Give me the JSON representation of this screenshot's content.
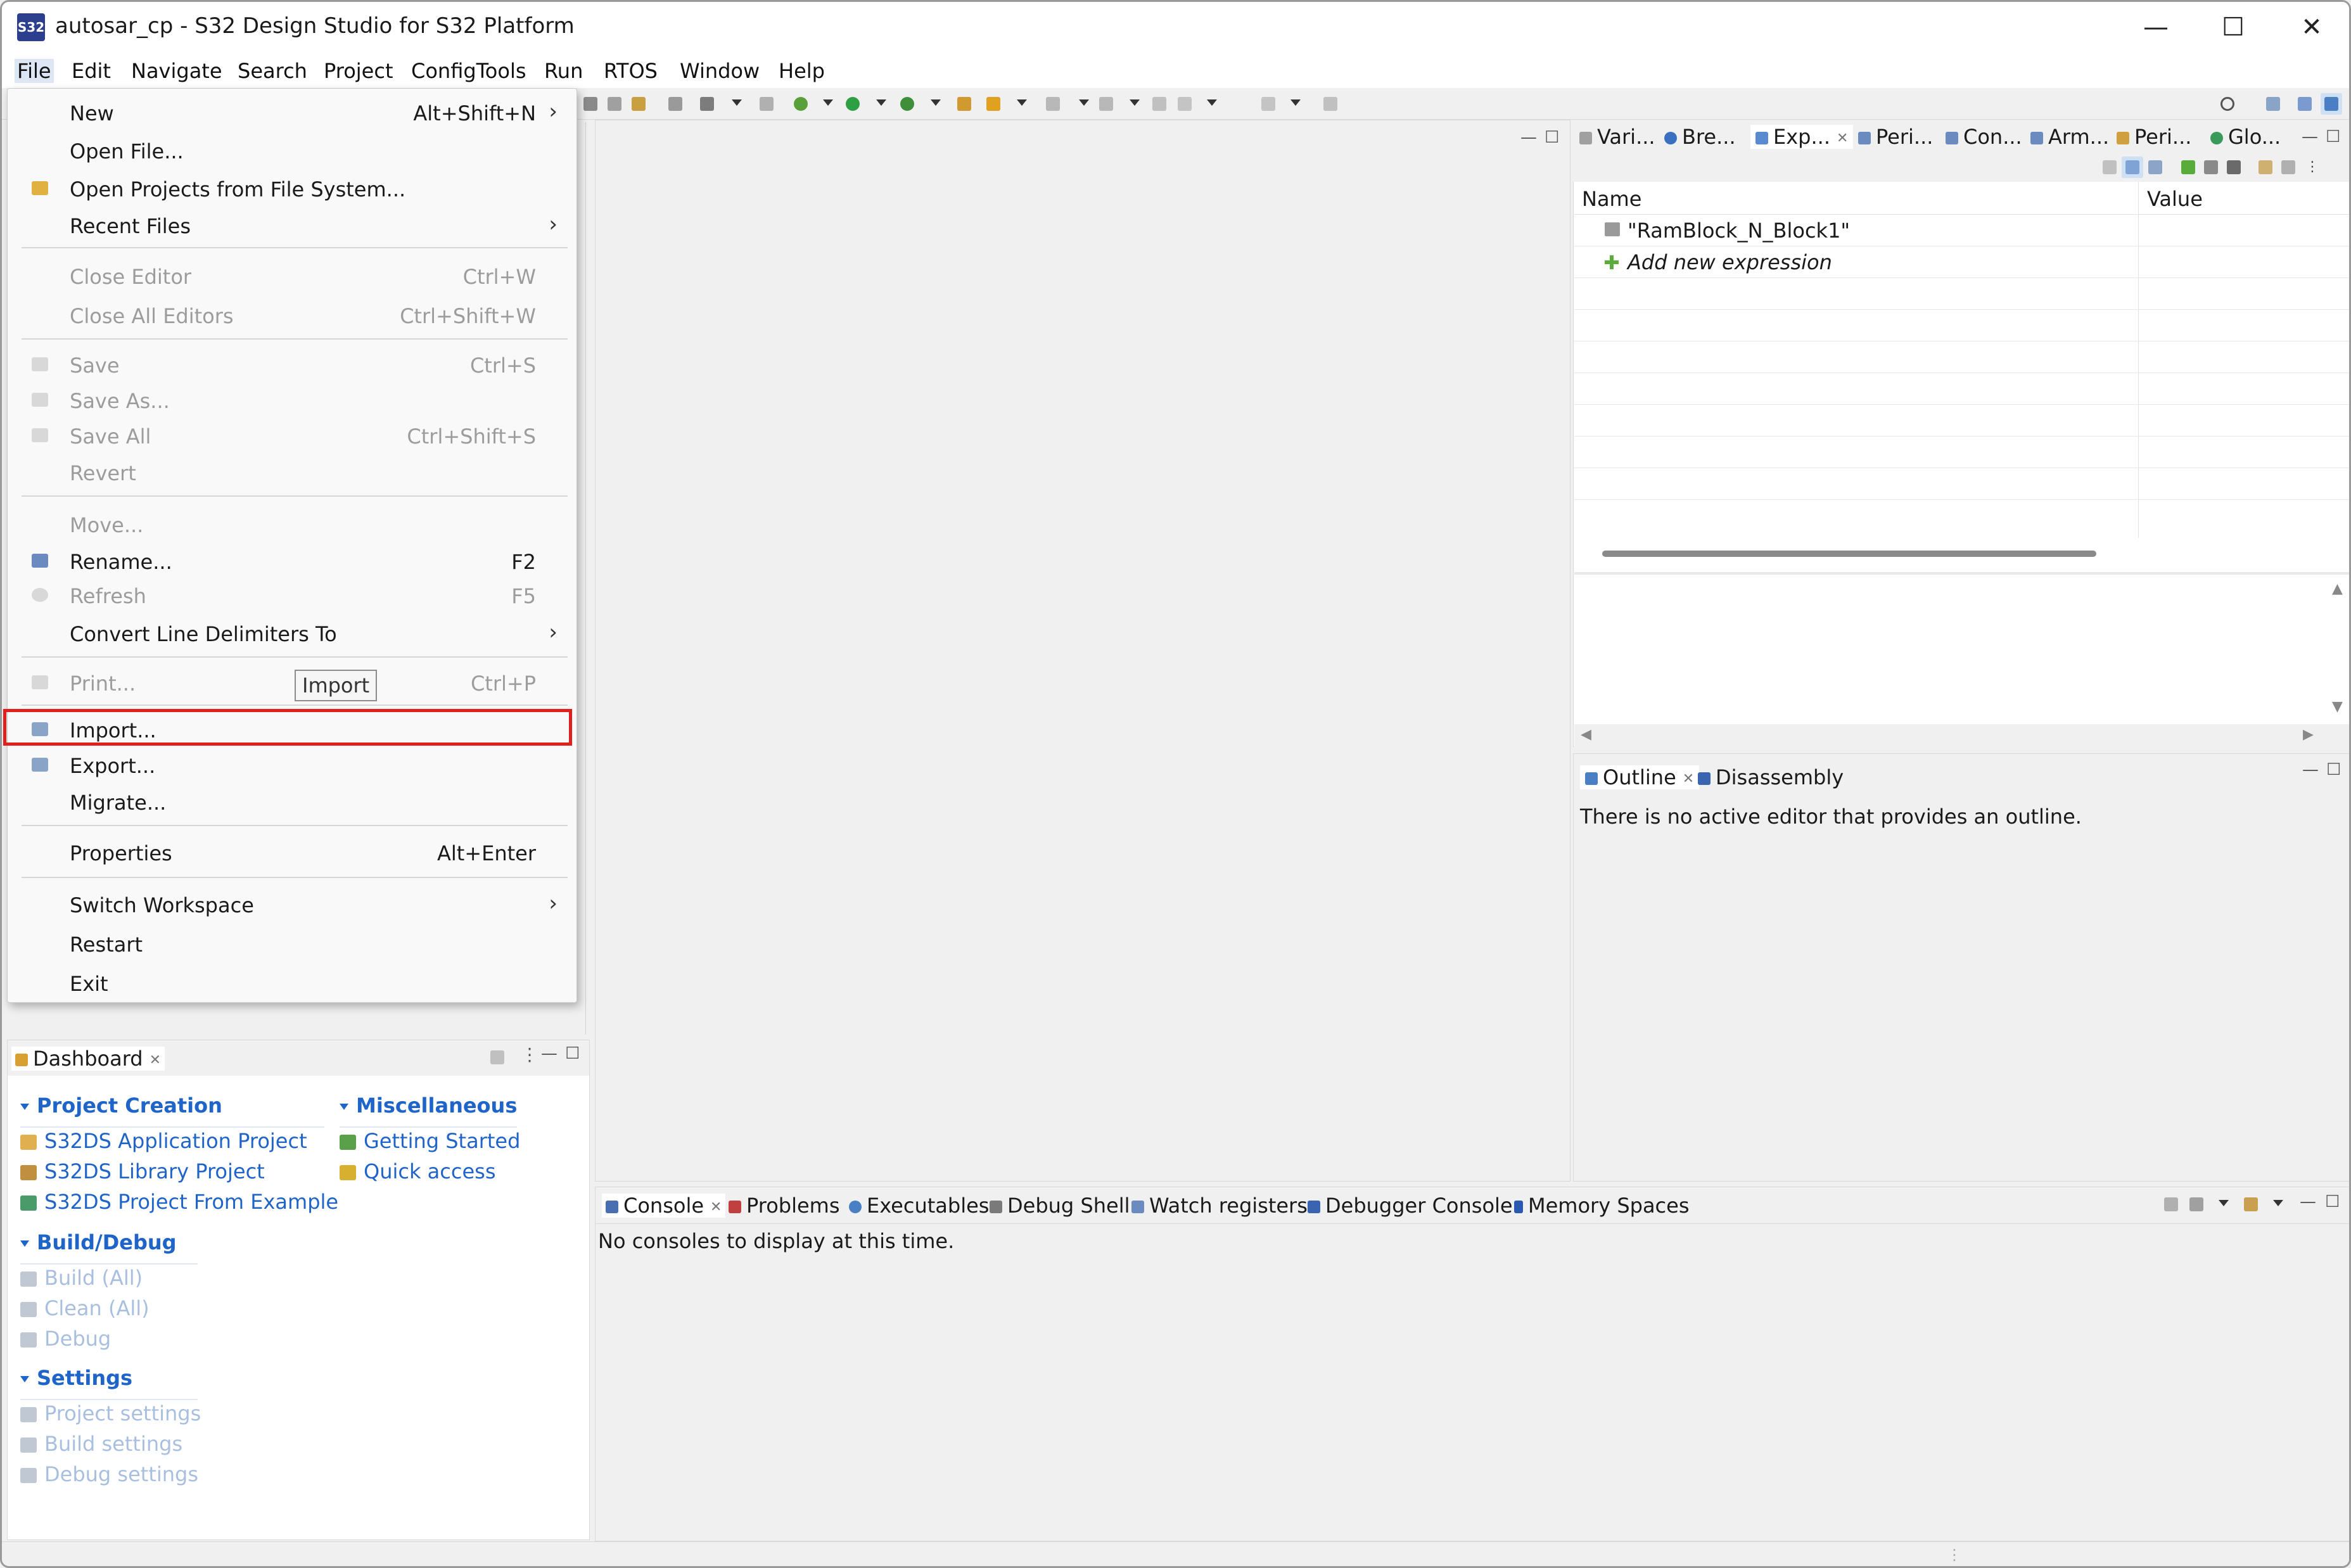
{
  "window": {
    "title": "autosar_cp - S32 Design Studio for S32 Platform",
    "app_icon_text": "S32",
    "controls": {
      "minimize": "—",
      "maximize": "☐",
      "close": "✕"
    }
  },
  "menubar": [
    {
      "label": "File"
    },
    {
      "label": "Edit"
    },
    {
      "label": "Navigate"
    },
    {
      "label": "Search"
    },
    {
      "label": "Project"
    },
    {
      "label": "ConfigTools"
    },
    {
      "label": "Run"
    },
    {
      "label": "RTOS"
    },
    {
      "label": "Window"
    },
    {
      "label": "Help"
    }
  ],
  "file_menu": {
    "items": [
      {
        "label": "New",
        "shortcut": "Alt+Shift+N",
        "submenu": true,
        "enabled": true
      },
      {
        "label": "Open File...",
        "shortcut": "",
        "enabled": true
      },
      {
        "label": "Open Projects from File System...",
        "shortcut": "",
        "enabled": true
      },
      {
        "label": "Recent Files",
        "shortcut": "",
        "submenu": true,
        "enabled": true
      },
      {
        "label": "Close Editor",
        "shortcut": "Ctrl+W",
        "enabled": false
      },
      {
        "label": "Close All Editors",
        "shortcut": "Ctrl+Shift+W",
        "enabled": false
      },
      {
        "label": "Save",
        "shortcut": "Ctrl+S",
        "enabled": false
      },
      {
        "label": "Save As...",
        "shortcut": "",
        "enabled": false
      },
      {
        "label": "Save All",
        "shortcut": "Ctrl+Shift+S",
        "enabled": false
      },
      {
        "label": "Revert",
        "shortcut": "",
        "enabled": false
      },
      {
        "label": "Move...",
        "shortcut": "",
        "enabled": false
      },
      {
        "label": "Rename...",
        "shortcut": "F2",
        "enabled": true
      },
      {
        "label": "Refresh",
        "shortcut": "F5",
        "enabled": false
      },
      {
        "label": "Convert Line Delimiters To",
        "shortcut": "",
        "submenu": true,
        "enabled": true
      },
      {
        "label": "Print...",
        "shortcut": "Ctrl+P",
        "enabled": false
      },
      {
        "label": "Import...",
        "shortcut": "",
        "enabled": true,
        "highlighted": true
      },
      {
        "label": "Export...",
        "shortcut": "",
        "enabled": true
      },
      {
        "label": "Migrate...",
        "shortcut": "",
        "enabled": true
      },
      {
        "label": "Properties",
        "shortcut": "Alt+Enter",
        "enabled": true
      },
      {
        "label": "Switch Workspace",
        "shortcut": "",
        "submenu": true,
        "enabled": true
      },
      {
        "label": "Restart",
        "shortcut": "",
        "enabled": true
      },
      {
        "label": "Exit",
        "shortcut": "",
        "enabled": true
      }
    ],
    "tooltip": "Import",
    "submenu_arrow": "›"
  },
  "top_right_tabs": [
    {
      "label": "Vari...",
      "icon": "variables-icon"
    },
    {
      "label": "Bre...",
      "icon": "breakpoints-icon"
    },
    {
      "label": "Exp...",
      "icon": "expressions-icon",
      "active": true
    },
    {
      "label": "Peri...",
      "icon": "peripherals-icon"
    },
    {
      "label": "Con...",
      "icon": "registers-icon"
    },
    {
      "label": "Arm...",
      "icon": "registers-icon"
    },
    {
      "label": "Peri...",
      "icon": "peripherals-icon"
    },
    {
      "label": "Glo...",
      "icon": "globals-icon"
    }
  ],
  "expressions": {
    "col_name": "Name",
    "col_value": "Value",
    "rows": [
      {
        "name": "\"RamBlock_N_Block1\"",
        "value": ""
      },
      {
        "name": "Add new expression",
        "value": ""
      }
    ]
  },
  "outline": {
    "tabs": [
      {
        "label": "Outline",
        "active": true
      },
      {
        "label": "Disassembly"
      }
    ],
    "message": "There is no active editor that provides an outline."
  },
  "console": {
    "tabs": [
      {
        "label": "Console",
        "active": true
      },
      {
        "label": "Problems"
      },
      {
        "label": "Executables"
      },
      {
        "label": "Debug Shell"
      },
      {
        "label": "Watch registers"
      },
      {
        "label": "Debugger Console"
      },
      {
        "label": "Memory Spaces"
      }
    ],
    "message": "No consoles to display at this time."
  },
  "dashboard": {
    "tab_label": "Dashboard",
    "sections": {
      "project_creation": {
        "title": "Project Creation",
        "links": [
          "S32DS Application Project",
          "S32DS Library Project",
          "S32DS Project From Example"
        ]
      },
      "miscellaneous": {
        "title": "Miscellaneous",
        "links": [
          "Getting Started",
          "Quick access"
        ]
      },
      "build_debug": {
        "title": "Build/Debug",
        "links": [
          "Build  (All)",
          "Clean  (All)",
          "Debug"
        ]
      },
      "settings": {
        "title": "Settings",
        "links": [
          "Project settings",
          "Build settings",
          "Debug settings"
        ]
      }
    }
  },
  "colors": {
    "highlight_border": "#e0201c",
    "link": "#1f64c8",
    "disabled_link": "#a9bfdf"
  }
}
